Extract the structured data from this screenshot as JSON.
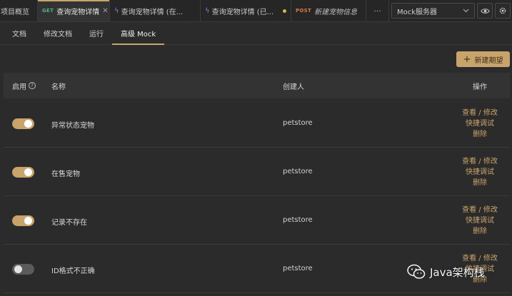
{
  "tabs": {
    "overview": "项目概览",
    "active": {
      "method": "GET",
      "label": "查询宠物详情"
    },
    "tab3": "查询宠物详情 (在...",
    "tab4": "查询宠物详情 (已...",
    "tab5": {
      "method": "POST",
      "label": "新建宠物信息"
    },
    "more": "···",
    "mock_server": "Mock服务器"
  },
  "subtabs": [
    "文档",
    "修改文档",
    "运行",
    "高级 Mock"
  ],
  "new_button": "新建期望",
  "table": {
    "headers": {
      "enable": "启用",
      "name": "名称",
      "creator": "创建人",
      "ops": "操作"
    },
    "rows": [
      {
        "enabled": true,
        "name": "异常状态宠物",
        "creator": "petstore"
      },
      {
        "enabled": true,
        "name": "在售宠物",
        "creator": "petstore"
      },
      {
        "enabled": true,
        "name": "记录不存在",
        "creator": "petstore"
      },
      {
        "enabled": false,
        "name": "ID格式不正确",
        "creator": "petstore"
      }
    ],
    "ops": {
      "view_edit": "查看 / 修改",
      "quick_debug": "快捷调试",
      "delete": "删除"
    }
  },
  "watermark": "Java架构栈",
  "colors": {
    "accent": "#c9a36c",
    "background": "#2b2b2b",
    "get": "#4fb38a",
    "post": "#d9774b"
  }
}
